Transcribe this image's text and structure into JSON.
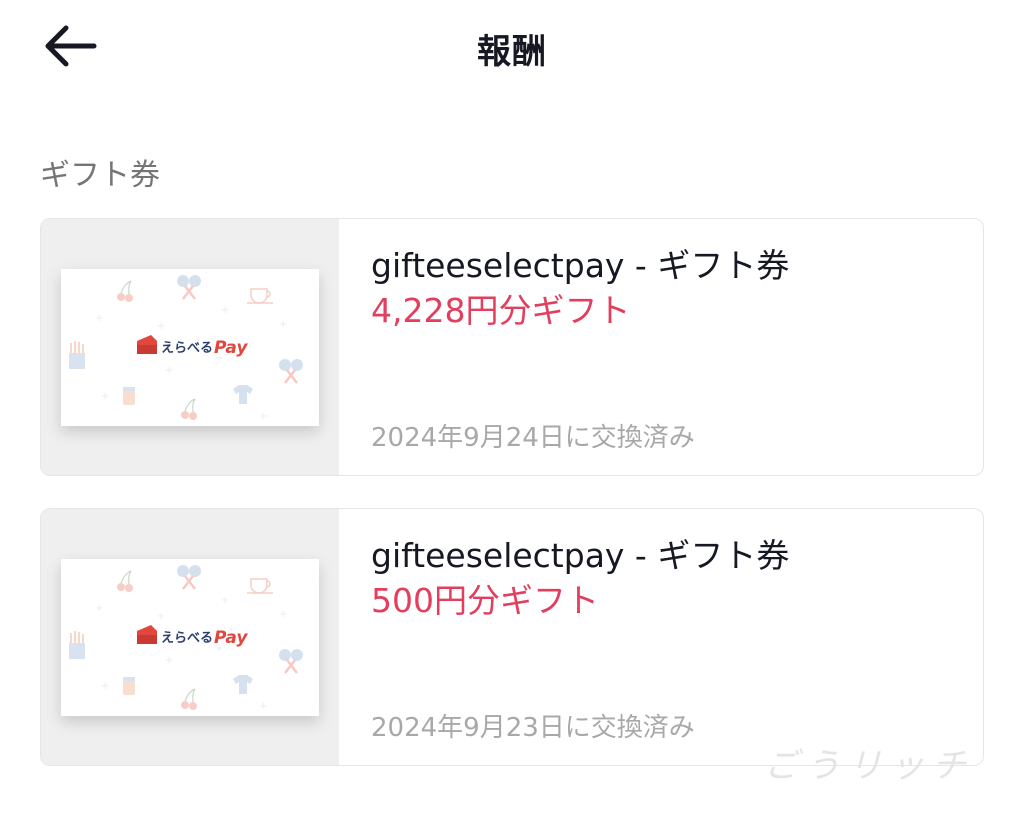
{
  "header": {
    "back_icon": "arrow-left-icon",
    "title": "報酬"
  },
  "section": {
    "label": "ギフト券"
  },
  "gift_cards": [
    {
      "name": "gifteeselectpay - ギフト券",
      "amount": "4,228円分ギフト",
      "date": "2024年9月24日に交換済み",
      "logo_text": "えらべる",
      "logo_pay": "Pay"
    },
    {
      "name": "gifteeselectpay - ギフト券",
      "amount": "500円分ギフト",
      "date": "2024年9月23日に交換済み",
      "logo_text": "えらべる",
      "logo_pay": "Pay"
    }
  ],
  "watermark": "ごうリッチ",
  "colors": {
    "amount": "#e23e5d",
    "date": "#a8a8a8",
    "section_label": "#757575",
    "logo_navy": "#2b3f6c",
    "logo_red": "#e0483e"
  }
}
